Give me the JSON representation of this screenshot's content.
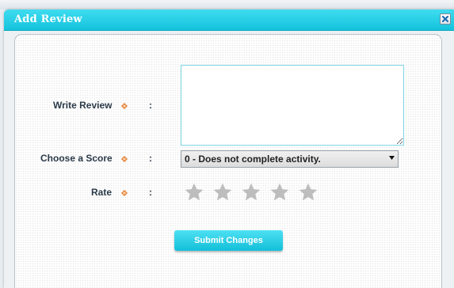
{
  "dialog": {
    "title": "Add Review",
    "close_icon": "close-x-icon"
  },
  "form": {
    "write_review": {
      "label": "Write Review",
      "colon": ":",
      "value": "",
      "required": true
    },
    "score": {
      "label": "Choose a Score",
      "colon": ":",
      "selected": "0 - Does not complete activity.",
      "required": true
    },
    "rate": {
      "label": "Rate",
      "colon": ":",
      "required": true,
      "max_stars": 5,
      "selected_stars": 0
    },
    "submit_label": "Submit Changes"
  },
  "colors": {
    "accent": "#1ac7df",
    "required_marker": "#e3823a",
    "star_empty": "#bdbdbd"
  }
}
